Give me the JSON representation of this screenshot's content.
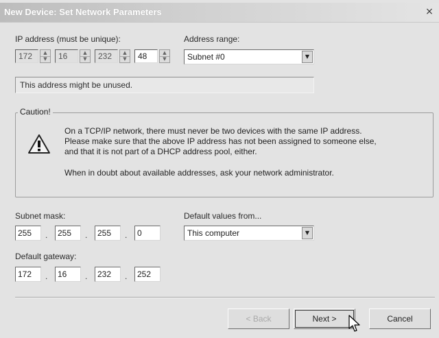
{
  "window": {
    "title": "New Device: Set Network Parameters",
    "close_glyph": "×"
  },
  "ip": {
    "label": "IP address (must be unique):",
    "octets": [
      "172",
      "16",
      "232",
      "48"
    ]
  },
  "range": {
    "label": "Address range:",
    "value": "Subnet #0"
  },
  "status_text": "This address might be unused.",
  "caution": {
    "title": "Caution!",
    "line1": "On a TCP/IP network, there must never be two devices with the same IP address.",
    "line2": "Please make sure that the above IP address has not been assigned to someone else,",
    "line3": "and that it is not part of a DHCP address pool, either.",
    "line4": "When in doubt about available addresses, ask your network administrator.",
    "icon": "warning-icon"
  },
  "subnet": {
    "label": "Subnet mask:",
    "octets": [
      "255",
      "255",
      "255",
      "0"
    ]
  },
  "defaults": {
    "label": "Default values from...",
    "value": "This computer"
  },
  "gateway": {
    "label": "Default gateway:",
    "octets": [
      "172",
      "16",
      "232",
      "252"
    ]
  },
  "buttons": {
    "back": "< Back",
    "next": "Next >",
    "cancel": "Cancel"
  },
  "separator": "."
}
